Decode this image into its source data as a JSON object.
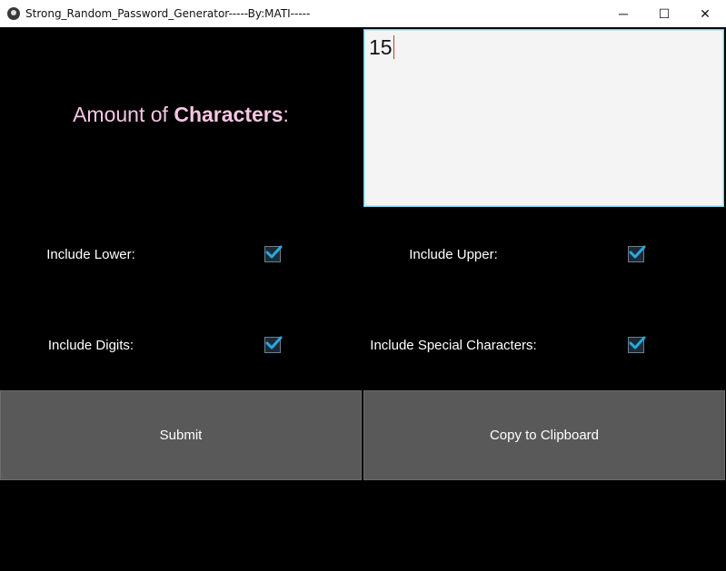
{
  "window": {
    "title": "Strong_Random_Password_Generator-----By:MATI-----",
    "icon": "kivy-app-icon",
    "controls": {
      "minimize": "─",
      "maximize": "☐",
      "close": "✕"
    }
  },
  "amount": {
    "label_prefix": "Amount of ",
    "label_bold": "Characters",
    "label_suffix": ":",
    "value": "15"
  },
  "options": {
    "lower": {
      "label": "Include Lower:",
      "checked": true
    },
    "upper": {
      "label": "Include Upper:",
      "checked": true
    },
    "digits": {
      "label": "Include Digits:",
      "checked": true
    },
    "special": {
      "label": "Include Special Characters:",
      "checked": true
    }
  },
  "buttons": {
    "submit": "Submit",
    "copy": "Copy to Clipboard"
  },
  "colors": {
    "background": "#000000",
    "label_pink": "#f5c6e4",
    "checkmark": "#2aa8e0",
    "button": "#595959"
  }
}
